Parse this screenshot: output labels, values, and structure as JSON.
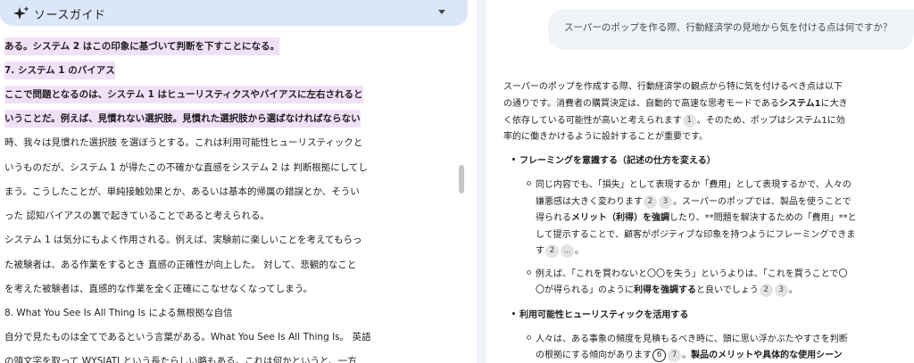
{
  "source_guide": {
    "label": "ソースガイド",
    "icon": "sparkle-icon",
    "toggle_icon": "caret-down-icon"
  },
  "source_lines": [
    {
      "text": "ある。システム 2 はこの印象に基づいて判断を下すことになる。",
      "style": "hl"
    },
    {
      "text": "7. システム 1 のバイアス",
      "style": "hl"
    },
    {
      "text": "ここで問題となるのは、システム 1 はヒューリスティクスやバイアスに左右されると",
      "style": "hl"
    },
    {
      "text": "いうことだ。例えば、見慣れない選択肢。見慣れた選択肢から選ばなければならない",
      "style": "hl"
    },
    {
      "text": "時、我々は見慣れた選択肢 を選ぼうとする。これは利用可能性ヒューリスティックと",
      "style": "normal"
    },
    {
      "text": "いうものだが、システム 1 が得たこの不確かな直感をシステム 2 は 判断根拠にしてし",
      "style": "normal"
    },
    {
      "text": "まう。こうしたことが、単純接触効果とか、あるいは基本的帰属の錯誤とか、そうい",
      "style": "normal"
    },
    {
      "text": "った 認知バイアスの裏で起きていることであると考えられる。",
      "style": "normal"
    },
    {
      "text": "システム 1 は気分にもよく作用される。例えば、実験前に楽しいことを考えてもらっ",
      "style": "normal"
    },
    {
      "text": "た被験者は、ある作業をするとき 直感の正確性が向上した。 対して、悲観的なこと",
      "style": "normal"
    },
    {
      "text": "を考えた被験者は、直感的な作業を全く正確にこなせなくなってしまう。",
      "style": "normal"
    },
    {
      "text": "8. What You See Is All Thing Is による無根拠な自信",
      "style": "normal"
    },
    {
      "text": "自分で見たものは全てであるという言葉がある。What You See Is All Thing Is。 英語",
      "style": "normal"
    },
    {
      "text": "の頭文字を取って WYSIATI という長たらしい略もある。これは何かというと、一方",
      "style": "normal"
    }
  ],
  "question": "スーパーのポップを作る際、行動経済学の見地から気を付ける点は何ですか？",
  "answer": {
    "intro": [
      [
        {
          "t": "スーパーのポップを作成する際、行動経済学の観点から特に気を付けるべき点は以下"
        }
      ],
      [
        {
          "t": "の通りです。消費者の購買決定は、自動的で高速な思考モードである"
        },
        {
          "t": "システム1",
          "b": true
        },
        {
          "t": "に大き"
        }
      ],
      [
        {
          "t": "く依存している可能性が高いと考えられます"
        },
        {
          "cite": "1"
        },
        {
          "t": "。そのため、ポップはシステム1に効"
        }
      ],
      [
        {
          "t": "率的に働きかけるように設計することが重要です。"
        }
      ]
    ],
    "heading1": "フレーミングを意識する（記述の仕方を変える）",
    "sub1": [
      [
        {
          "t": "同じ内容でも、「損失」として表現するか「費用」として表現するかで、人々の"
        }
      ],
      [
        {
          "t": "嫌悪感は大きく変わります"
        },
        {
          "cite": "2"
        },
        {
          "cite": "3"
        },
        {
          "t": "。スーパーのポップでは、製品を使うことで"
        }
      ],
      [
        {
          "t": "得られる"
        },
        {
          "t": "メリット（利得）を強調",
          "b": true
        },
        {
          "t": "したり、**問題を解決するための「費用」**と"
        }
      ],
      [
        {
          "t": "して提示することで、顧客がポジティブな印象を持つようにフレーミングできま"
        }
      ],
      [
        {
          "t": "す"
        },
        {
          "cite": "2"
        },
        {
          "cite": "..."
        },
        {
          "t": "。"
        }
      ]
    ],
    "sub2": [
      [
        {
          "t": "例えば、「これを買わないと〇〇を失う」というよりは、「これを買うことで〇"
        }
      ],
      [
        {
          "t": "〇が得られる」のように"
        },
        {
          "t": "利得を強調する",
          "b": true
        },
        {
          "t": "と良いでしょう"
        },
        {
          "cite": "2"
        },
        {
          "cite": "3"
        },
        {
          "t": "。"
        }
      ]
    ],
    "heading2": "利用可能性ヒューリスティックを活用する",
    "sub3": [
      [
        {
          "t": "人々は、ある事象の頻度を見積もるべき時に、頭に思い浮かぶたやすさを判断"
        }
      ],
      [
        {
          "t": "の根拠にする傾向があります"
        },
        {
          "cite": "6",
          "ring": true
        },
        {
          "cite": "7"
        },
        {
          "t": "。"
        },
        {
          "t": "製品のメリットや具体的な使用シーン",
          "b": true
        }
      ]
    ]
  }
}
